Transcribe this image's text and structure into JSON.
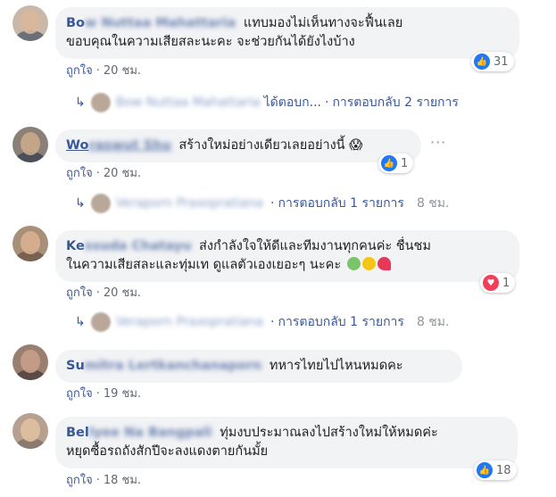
{
  "comments": [
    {
      "name_visible": "Bo",
      "name_blurred": "w Nuttaa Mahattaria",
      "lines": [
        "แทบมองไม่เห็นทางจะฟื้นเลย",
        "ขอบคุณในความเสียสละนะคะ จะช่วยกันได้ยังไงบ้าง"
      ],
      "reaction": {
        "type": "like",
        "count": "31"
      },
      "like_label": "ถูกใจ",
      "time": "20 ชม.",
      "reply": {
        "name_blurred": "Bow Nuttaa Mahattaria",
        "suffix": "ได้ตอบก...",
        "count_label": "การตอบกลับ 2 รายการ",
        "time": ""
      }
    },
    {
      "name_visible": "Wo",
      "name_blurred": "raswut Shu",
      "lines": [
        "สร้างใหม่อย่างเดียวเลยอย่างนี้ 😱"
      ],
      "reaction": {
        "type": "like",
        "count": "1"
      },
      "like_label": "ถูกใจ",
      "time": "20 ชม.",
      "reply": {
        "name_blurred": "Veraporn Praxopratiana",
        "suffix": "",
        "count_label": "การตอบกลับ 1 รายการ",
        "time": "8 ชม."
      }
    },
    {
      "name_visible": "Ke",
      "name_blurred": "ssuda Chatayu",
      "lines": [
        "ส่งกำลังใจให้ดีและทีมงานทุกคนค่ะ ชื่นชม",
        "ในความเสียสละและทุ่มเท ดูแลตัวเองเยอะๆ นะคะ"
      ],
      "reaction": {
        "type": "love",
        "count": "1"
      },
      "like_label": "ถูกใจ",
      "time": "20 ชม.",
      "reply": {
        "name_blurred": "Veraporn Praxopratiana",
        "suffix": "",
        "count_label": "การตอบกลับ 1 รายการ",
        "time": "8 ชม."
      }
    },
    {
      "name_visible": "Su",
      "name_blurred": "mitra Lertkanchanaporn",
      "lines": [
        "ทหารไทยไปไหนหมดคะ"
      ],
      "reaction": null,
      "like_label": "ถูกใจ",
      "time": "19 ชม."
    },
    {
      "name_visible": "Bel",
      "name_blurred": "lyee Na Bangpali",
      "lines": [
        "ทุ่มงบประมาณลงไปสร้างใหม่ให้หมดค่ะ",
        "หยุดซื้อรถถังสักปีจะลงแดงตายกันมั้ย"
      ],
      "reaction": {
        "type": "like",
        "count": "18"
      },
      "like_label": "ถูกใจ",
      "time": "18 ชม."
    }
  ],
  "separator": "·",
  "icons": {
    "like": "thumbs-up-icon",
    "love": "heart-icon",
    "reply_arrow": "reply-arrow-icon",
    "more": "more-options-icon"
  },
  "colors": {
    "link": "#385898",
    "bubble": "#f2f3f5",
    "like_blue": "#2078f4",
    "love_red": "#f33e58"
  }
}
